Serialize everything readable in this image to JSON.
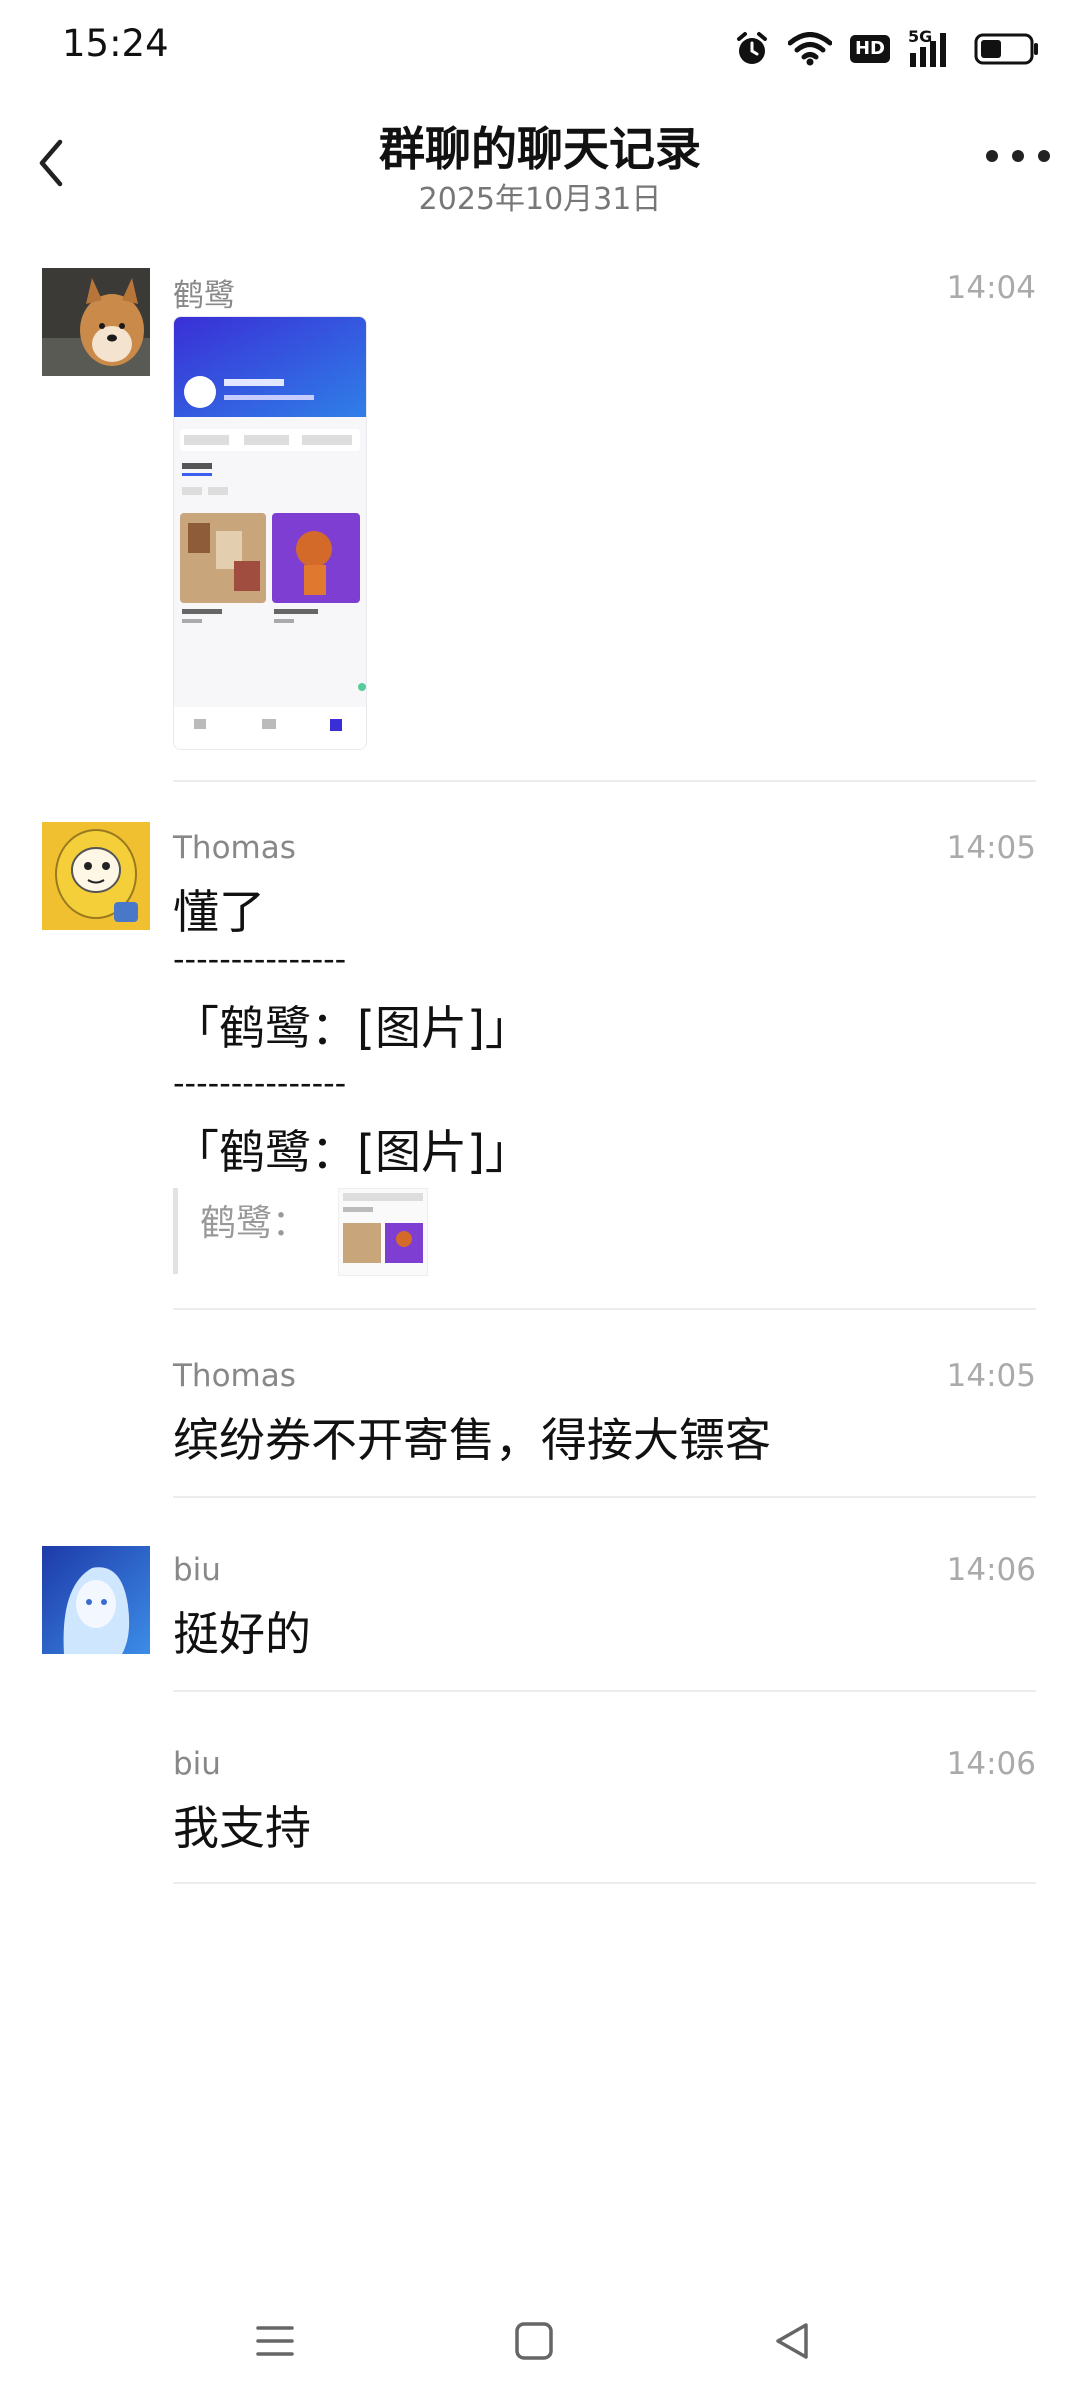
{
  "status_bar": {
    "time": "15:24",
    "icons": [
      "alarm-icon",
      "wifi-icon",
      "hd-icon",
      "signal-5g-icon",
      "battery-icon"
    ],
    "hd_label": "HD",
    "network_label": "5G"
  },
  "header": {
    "title": "群聊的聊天记录",
    "subtitle": "2025年10月31日",
    "back_icon": "chevron-left-icon",
    "more_icon": "more-dots-icon"
  },
  "messages": [
    {
      "sender": "鹤鹭",
      "time": "14:04",
      "type": "image",
      "avatar": "shiba-dog-avatar"
    },
    {
      "sender": "Thomas",
      "time": "14:05",
      "type": "text",
      "avatar": "yellow-cartoon-avatar",
      "lines": [
        "懂了",
        "---------------",
        "「鹤鹭：[图片]」",
        "---------------",
        "「鹤鹭：[图片]」"
      ],
      "quote": {
        "sender": "鹤鹭："
      }
    },
    {
      "sender": "Thomas",
      "time": "14:05",
      "type": "text",
      "text": "缤纷券不开寄售，得接大镖客"
    },
    {
      "sender": "biu",
      "time": "14:06",
      "type": "text",
      "avatar": "anime-girl-avatar",
      "text": "挺好的"
    },
    {
      "sender": "biu",
      "time": "14:06",
      "type": "text",
      "text": "我支持"
    }
  ],
  "nav_bar": {
    "icons": [
      "menu-icon",
      "home-icon",
      "back-icon"
    ]
  },
  "colors": {
    "background": "#ffffff",
    "text_primary": "#111111",
    "text_secondary": "#888888",
    "divider": "#ececec"
  }
}
